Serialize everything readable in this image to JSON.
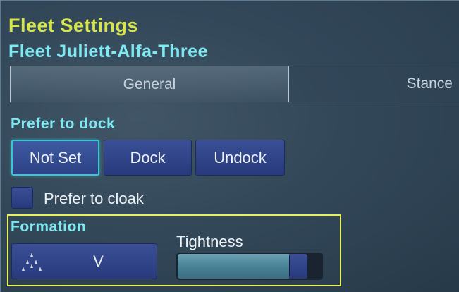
{
  "window": {
    "title": "Fleet Settings",
    "fleet_name": "Fleet Juliett-Alfa-Three"
  },
  "tabs": [
    {
      "label": "General",
      "active": true
    },
    {
      "label": "Stance",
      "active": false
    }
  ],
  "dock": {
    "label": "Prefer to dock",
    "options": [
      {
        "label": "Not Set",
        "selected": true
      },
      {
        "label": "Dock",
        "selected": false
      },
      {
        "label": "Undock",
        "selected": false
      }
    ]
  },
  "cloak": {
    "label": "Prefer to cloak",
    "checked": false
  },
  "formation": {
    "label": "Formation",
    "value": "V",
    "icon": "v-formation-icon",
    "tightness_label": "Tightness",
    "tightness": 0.88
  },
  "colors": {
    "title": "#d6e64a",
    "accent": "#7ee9f0",
    "button": "#2d4286",
    "highlight_border": "#e8f05a"
  }
}
